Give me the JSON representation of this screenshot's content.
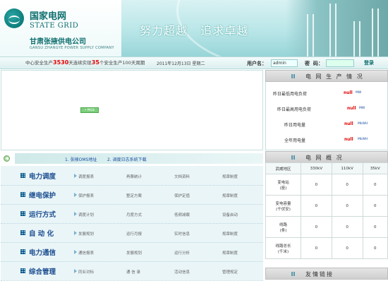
{
  "header": {
    "logo_cn": "国家电网",
    "logo_en": "STATE GRID",
    "company_cn": "甘肃张掖供电公司",
    "company_en": "GANSU ZHANGYE POWER SUPPLY COMPANY",
    "slogan": "努力超越   追求卓越",
    "colors": {
      "teal": "#0e6e6e",
      "header_bg": "#b9e6e8"
    }
  },
  "infobar": {
    "safety_prefix": "中心安全生产",
    "safety_days": "3530",
    "safety_mid": "天连续实现",
    "safety_count": "35",
    "safety_suffix": "个安全生产100天周期",
    "date": "2011年12月13日 星期二",
    "user_label": "用户名：",
    "user_value": "admin",
    "pass_label": "密  码：",
    "login_label": "登录"
  },
  "main": {
    "badge": "• PAGE"
  },
  "linkbar": {
    "links": [
      "1. 张掖OMS地址",
      "2. 调度日志系统下载"
    ]
  },
  "menu": {
    "rows": [
      {
        "title": "电力调度",
        "subs": [
          "调度报表",
          "再票统计",
          "文档资料",
          "规章制度"
        ]
      },
      {
        "title": "继电保护",
        "subs": [
          "保护报表",
          "整定方案",
          "保护定值",
          "规章制度"
        ]
      },
      {
        "title": "运行方式",
        "subs": [
          "调度计划",
          "月度方式",
          "低频减载",
          "设备启动"
        ]
      },
      {
        "title": "自 动 化",
        "subs": [
          "发展规划",
          "运行月报",
          "实时信息",
          "规章制度"
        ]
      },
      {
        "title": "电力通信",
        "subs": [
          "通信报表",
          "发展规划",
          "运行分析",
          "规章制度"
        ]
      },
      {
        "title": "综合管理",
        "subs": [
          "同业对标",
          "通 信 录",
          "活动信息",
          "管理规定"
        ]
      }
    ]
  },
  "production": {
    "heading": "电 网 生 产 情 况",
    "items": [
      {
        "label": "昨日最低用电负荷",
        "value": "null",
        "unit": "MW"
      },
      {
        "label": "昨日最高用电负荷",
        "value": "null",
        "unit": "MW"
      },
      {
        "label": "昨日用电量",
        "value": "null",
        "unit": "MkWH"
      },
      {
        "label": "全年用电量",
        "value": "null",
        "unit": "MkWH"
      }
    ]
  },
  "grid": {
    "heading": "电 网 概 况",
    "columns": [
      "武威地区",
      "330kV",
      "110kV",
      "35kV"
    ],
    "rows": [
      {
        "label": "变电站\n(座)",
        "values": [
          "0",
          "0",
          "0"
        ]
      },
      {
        "label": "变电容量\n(千伏安)",
        "values": [
          "0",
          "0",
          "0"
        ]
      },
      {
        "label": "线路\n(条)",
        "values": [
          "0",
          "0",
          "0"
        ]
      },
      {
        "label": "线路总长\n(千米)",
        "values": [
          "0",
          "0",
          "0"
        ]
      }
    ]
  },
  "links_panel": {
    "heading": "友情链接"
  }
}
